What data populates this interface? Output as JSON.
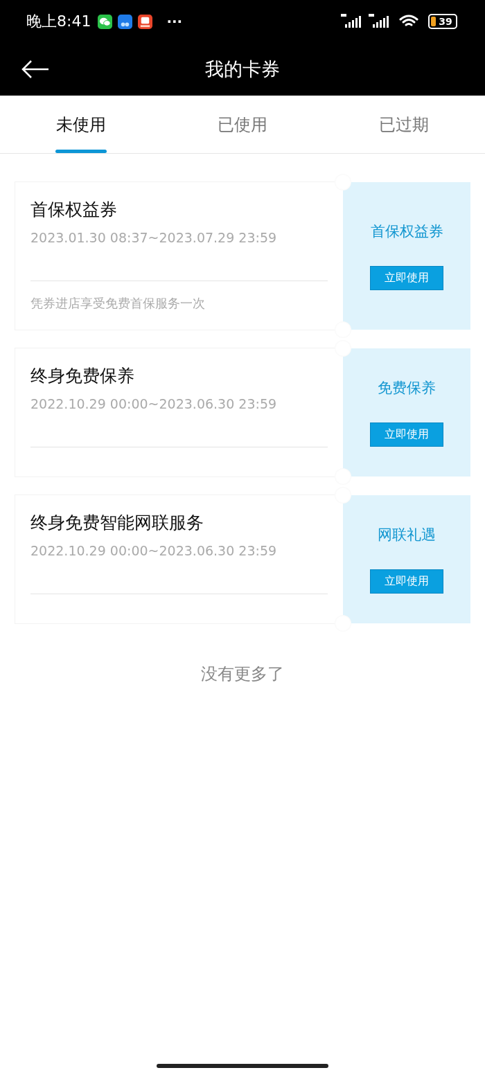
{
  "status_bar": {
    "time": "晚上8:41",
    "more": "···",
    "battery": "39"
  },
  "header": {
    "title": "我的卡券"
  },
  "tabs": [
    {
      "label": "未使用",
      "selected": true
    },
    {
      "label": "已使用",
      "selected": false
    },
    {
      "label": "已过期",
      "selected": false
    }
  ],
  "coupons": [
    {
      "title": "首保权益券",
      "period": "2023.01.30 08:37~2023.07.29 23:59",
      "note": "凭券进店享受免费首保服务一次",
      "badge": "首保权益券",
      "button": "立即使用"
    },
    {
      "title": "终身免费保养",
      "period": "2022.10.29 00:00~2023.06.30 23:59",
      "badge": "免费保养",
      "button": "立即使用"
    },
    {
      "title": "终身免费智能网联服务",
      "period": "2022.10.29 00:00~2023.06.30 23:59",
      "badge": "网联礼遇",
      "button": "立即使用"
    }
  ],
  "end_text": "没有更多了"
}
